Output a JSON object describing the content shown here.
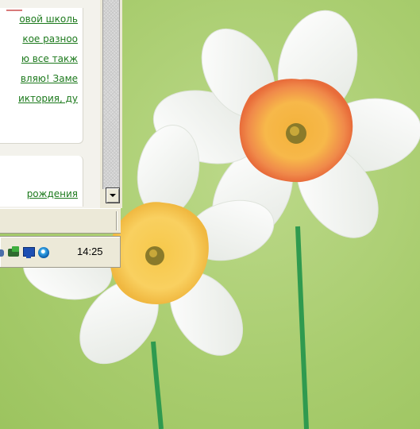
{
  "browser": {
    "post_links": [
      "овой школь",
      "кое разноо",
      "ю все такж",
      "вляю! Заме",
      "иктория, ду"
    ],
    "second_post_link": "рождения"
  },
  "taskbar": {
    "clock": "14:25",
    "tray_icons": [
      "app-icon",
      "network-icon",
      "display-icon",
      "media-icon"
    ]
  },
  "wallpaper": {
    "subject": "white daffodils",
    "background_color": "#a9cd6f",
    "link_color": "#1d7a1d"
  }
}
